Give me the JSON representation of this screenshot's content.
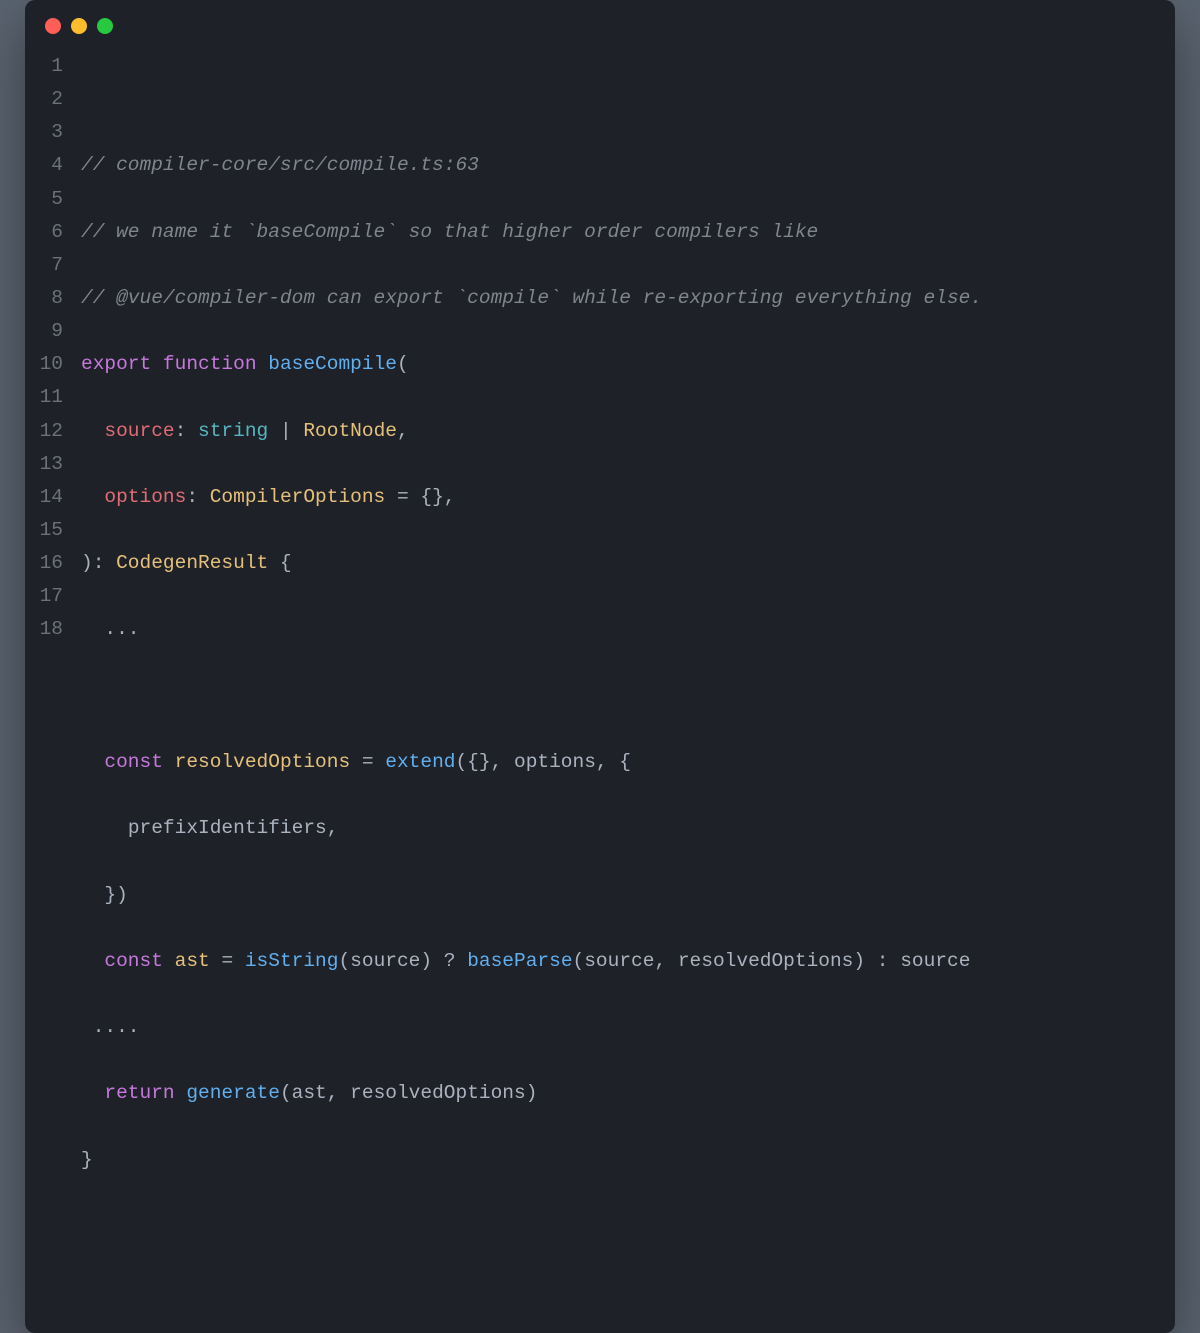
{
  "traffic_lights": {
    "close": "close",
    "minimize": "minimize",
    "maximize": "maximize"
  },
  "line_numbers": [
    "1",
    "2",
    "3",
    "4",
    "5",
    "6",
    "7",
    "8",
    "9",
    "10",
    "11",
    "12",
    "13",
    "14",
    "15",
    "16",
    "17",
    "18"
  ],
  "code": {
    "l2": {
      "comment": "// compiler-core/src/compile.ts:63"
    },
    "l3": {
      "comment": "// we name it `baseCompile` so that higher order compilers like"
    },
    "l4": {
      "comment": "// @vue/compiler-dom can export `compile` while re-exporting everything else."
    },
    "l5": {
      "kw_export": "export",
      "kw_function": "function",
      "fn_name": "baseCompile",
      "paren_open": "("
    },
    "l6": {
      "indent": "  ",
      "param_source": "source",
      "colon1": ": ",
      "type_string": "string",
      "pipe": " | ",
      "type_rootnode": "RootNode",
      "comma": ","
    },
    "l7": {
      "indent": "  ",
      "param_options": "options",
      "colon1": ": ",
      "type_compileropts": "CompilerOptions",
      "eq": " = ",
      "braces": "{}",
      "comma": ","
    },
    "l8": {
      "paren_close": ")",
      "colon": ": ",
      "type_codegen": "CodegenResult",
      "brace_open": " {"
    },
    "l9": {
      "indent": "  ",
      "dots": "..."
    },
    "l11": {
      "indent": "  ",
      "kw_const": "const",
      "var_resolved": " resolvedOptions ",
      "eq": "= ",
      "fn_extend": "extend",
      "args": "({}, options, {"
    },
    "l12": {
      "indent": "    ",
      "id_prefix": "prefixIdentifiers",
      "comma": ","
    },
    "l13": {
      "indent": "  ",
      "close": "})"
    },
    "l14": {
      "indent": "  ",
      "kw_const": "const",
      "var_ast": " ast ",
      "eq": "= ",
      "fn_isstring": "isString",
      "po": "(",
      "arg_source": "source",
      "pc": ") ",
      "q": "? ",
      "fn_baseparse": "baseParse",
      "po2": "(",
      "arg_source2": "source",
      "comma": ", ",
      "arg_resolved": "resolvedOptions",
      "pc2": ") ",
      "colon": ": ",
      "arg_source3": "source"
    },
    "l15": {
      "indent": " ",
      "dots": "...."
    },
    "l16": {
      "indent": "  ",
      "kw_return": "return",
      "sp": " ",
      "fn_generate": "generate",
      "po": "(",
      "arg_ast": "ast",
      "comma": ", ",
      "arg_resolved": "resolvedOptions",
      "pc": ")"
    },
    "l17": {
      "brace_close": "}"
    }
  }
}
